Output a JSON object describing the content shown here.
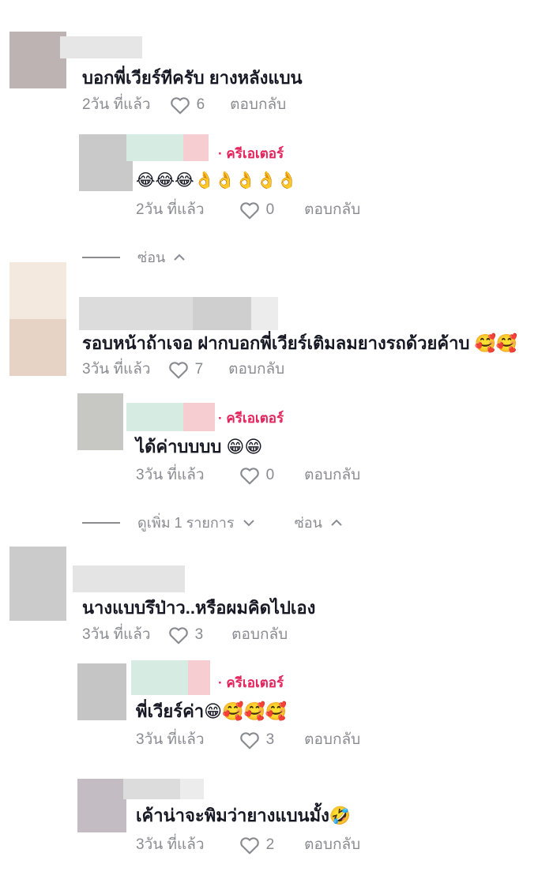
{
  "icons": {
    "like": "heart-outline-icon",
    "chevron_up": "chevron-up-icon",
    "chevron_down": "chevron-down-icon"
  },
  "colors": {
    "creator_badge": "#e3245c",
    "meta_text": "#8a8b91",
    "comment_text": "#161823"
  },
  "comments": [
    {
      "text": "บอกพี่เวียร์ทีครับ ยางหลังแบน",
      "time": "2วัน ที่แล้ว",
      "likes": "6",
      "reply_label": "ตอบกลับ",
      "replies": [
        {
          "creator_label": "· ครีเอเตอร์",
          "text": "😂😂😂👌👌👌👌👌",
          "time": "2วัน ที่แล้ว",
          "likes": "0",
          "reply_label": "ตอบกลับ"
        }
      ],
      "hide_label": "ซ่อน"
    },
    {
      "text": "รอบหน้าถ้าเจอ ฝากบอกพี่เวียร์เติมลมยางรถด้วยค้าบ 🥰🥰",
      "time": "3วัน ที่แล้ว",
      "likes": "7",
      "reply_label": "ตอบกลับ",
      "replies": [
        {
          "creator_label": "· ครีเอเตอร์",
          "text": "ได้ค่าบบบบ 😁😁",
          "time": "3วัน ที่แล้ว",
          "likes": "0",
          "reply_label": "ตอบกลับ"
        }
      ],
      "view_more_label": "ดูเพิ่ม 1 รายการ",
      "hide_label": "ซ่อน"
    },
    {
      "text": "นางแบบรึป่าว..หรือผมคิดไปเอง",
      "time": "3วัน ที่แล้ว",
      "likes": "3",
      "reply_label": "ตอบกลับ",
      "replies": [
        {
          "creator_label": "· ครีเอเตอร์",
          "text": "พี่เวียร์ค่า😁🥰🥰🥰",
          "time": "3วัน ที่แล้ว",
          "likes": "3",
          "reply_label": "ตอบกลับ"
        },
        {
          "text": "เค้าน่าจะพิมว่ายางแบนมั้ง🤣",
          "time": "3วัน ที่แล้ว",
          "likes": "2",
          "reply_label": "ตอบกลับ"
        }
      ]
    }
  ]
}
